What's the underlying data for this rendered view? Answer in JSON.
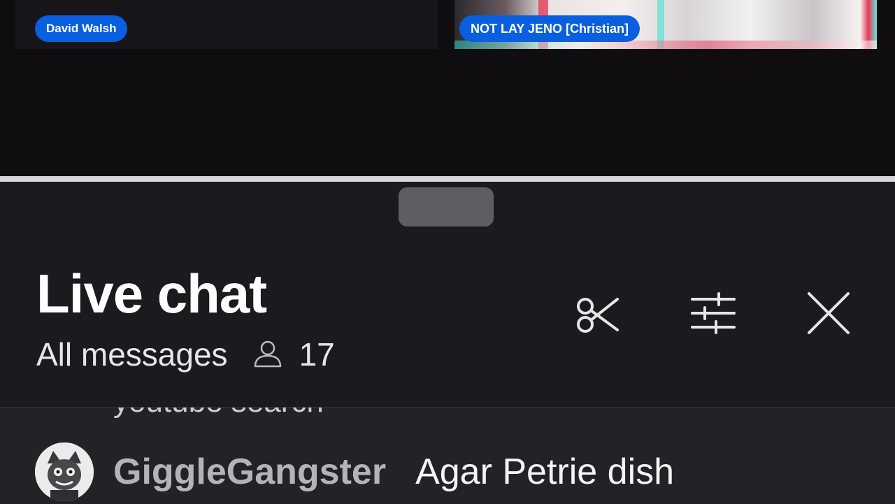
{
  "video": {
    "left_participant": "David Walsh",
    "right_participant": "NOT LAY JENO [Christian]"
  },
  "chat": {
    "title": "Live chat",
    "filter_label": "All messages",
    "viewer_count": "17",
    "icons": {
      "clip": "scissors-icon",
      "filter": "sliders-icon",
      "close": "close-icon",
      "viewers": "person-icon"
    },
    "truncated_message": "youtube search",
    "messages": [
      {
        "author": "GiggleGangster",
        "text": "Agar Petrie dish"
      }
    ]
  }
}
